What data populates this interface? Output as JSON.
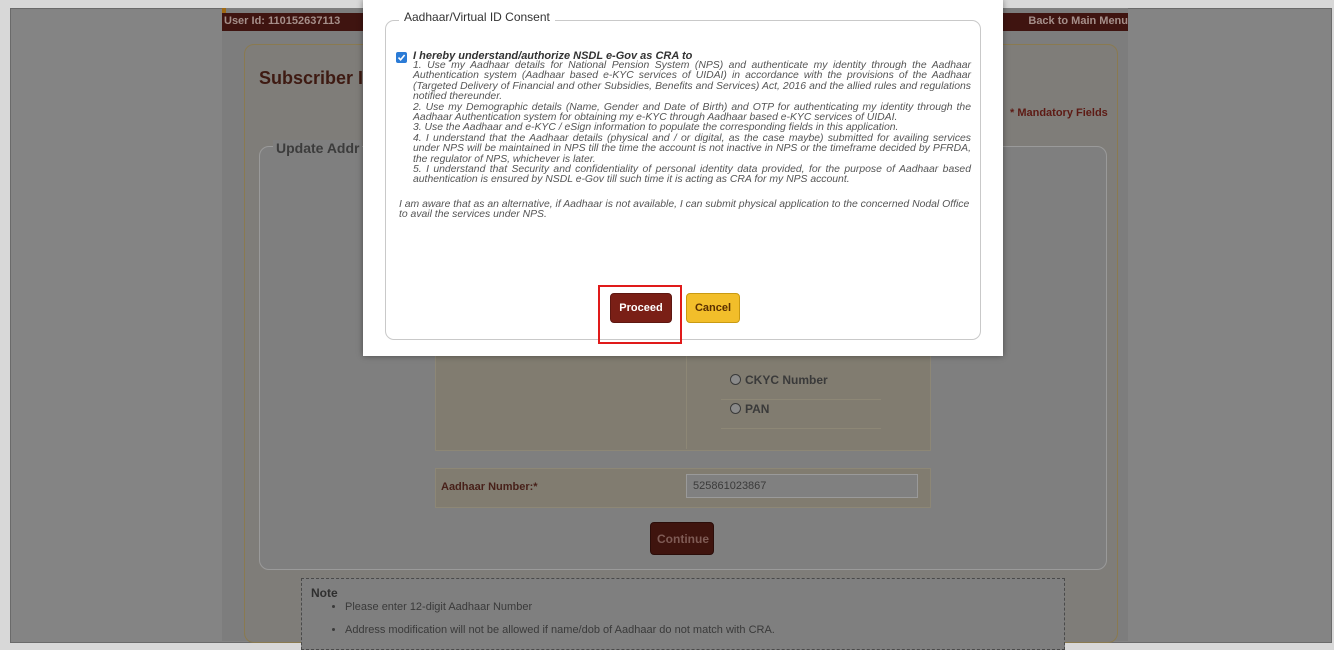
{
  "header": {
    "user_id": "User Id: 110152637113",
    "back_link": "Back to Main Menu"
  },
  "page": {
    "title": "Subscriber I",
    "mandatory_note": "* Mandatory Fields",
    "section_legend": "Update Addr"
  },
  "options": {
    "ckyc_label": "CKYC Number",
    "pan_label": "PAN"
  },
  "aadhaar": {
    "label": "Aadhaar Number:*",
    "value": "525861023867"
  },
  "continue_label": "Continue",
  "note": {
    "title": "Note",
    "items": [
      "Please enter 12-digit Aadhaar Number",
      "Address modification will not be allowed if name/dob of Aadhaar do not match with CRA."
    ]
  },
  "modal": {
    "legend": "Aadhaar/Virtual ID Consent",
    "checked": true,
    "consent_title": "I hereby understand/authorize NSDL e-Gov as CRA to",
    "points": [
      "1. Use my Aadhaar details for National Pension System (NPS) and authenticate my identity through the Aadhaar Authentication system (Aadhaar based e-KYC services of UIDAI) in accordance with the provisions of the Aadhaar (Targeted Delivery of Financial and other Subsidies, Benefits and Services) Act, 2016 and the allied rules and regulations notified thereunder.",
      "2. Use my Demographic details (Name, Gender and Date of Birth) and OTP for authenticating my identity through the Aadhaar Authentication system for obtaining my e-KYC through Aadhaar based e-KYC services of UIDAI.",
      "3. Use the Aadhaar and e-KYC / eSign information to populate the corresponding fields in this application.",
      "4. I understand that the Aadhaar details (physical and / or digital, as the case maybe) submitted for availing services under NPS will be maintained in NPS till the time the account is not inactive in NPS or the timeframe decided by PFRDA, the regulator of NPS, whichever is later.",
      "5. I understand that Security and confidentiality of personal identity data provided, for the purpose of Aadhaar based authentication is ensured by NSDL e-Gov till such time it is acting as CRA for my NPS account."
    ],
    "closing": "I am aware that as an alternative, if Aadhaar is not available, I can submit physical application to the concerned Nodal Office to avail the services under NPS.",
    "proceed_label": "Proceed",
    "cancel_label": "Cancel"
  },
  "colors": {
    "brand_maroon": "#7a1f16",
    "cancel_yellow": "#f2be2a",
    "highlight_red": "#e01a1a",
    "checkbox_blue": "#2b7bd6"
  }
}
